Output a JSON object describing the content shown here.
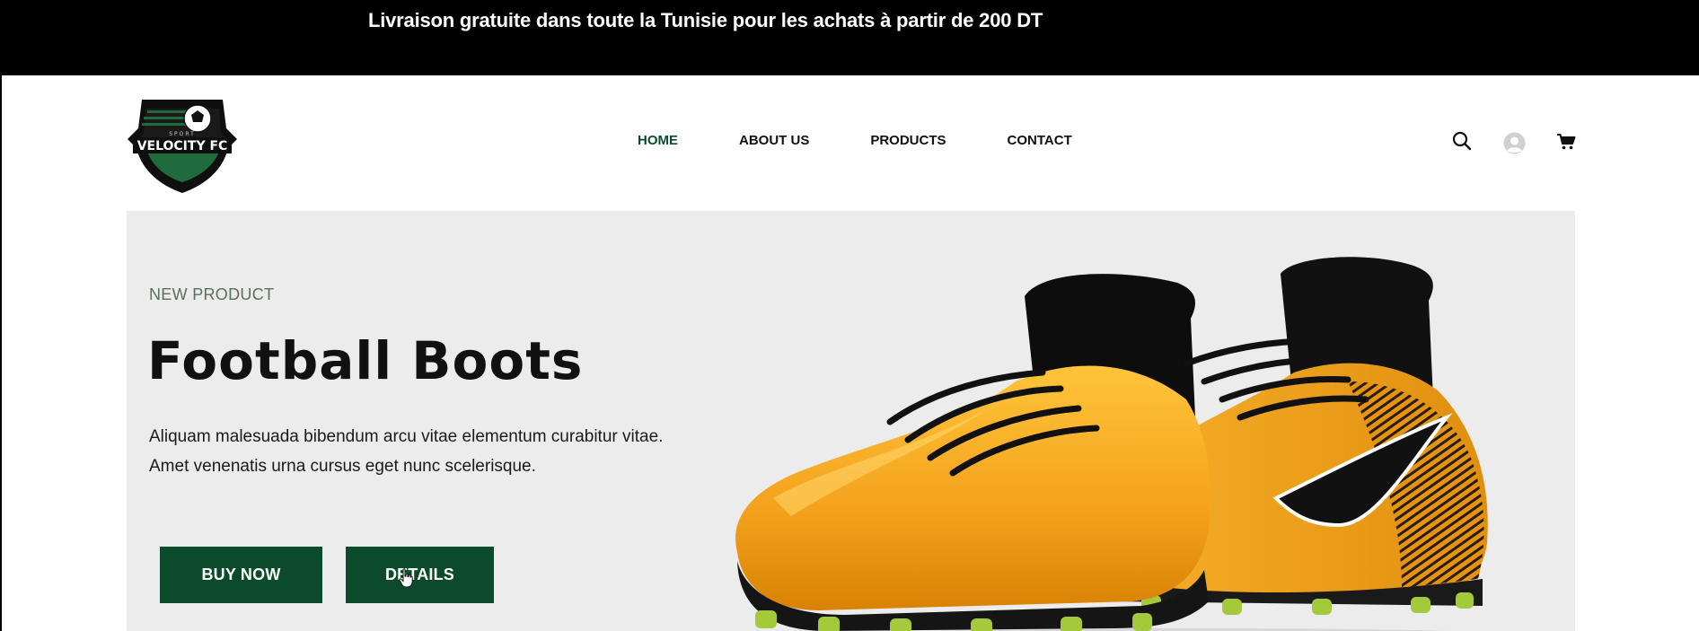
{
  "announcement": {
    "text": "Livraison gratuite dans toute la Tunisie pour les achats à partir de 200 DT"
  },
  "header": {
    "logo_text": "VELOCITY FC",
    "nav": [
      {
        "label": "HOME",
        "active": true
      },
      {
        "label": "ABOUT US",
        "active": false
      },
      {
        "label": "PRODUCTS",
        "active": false
      },
      {
        "label": "CONTACT",
        "active": false
      }
    ],
    "icons": [
      "search-icon",
      "user-icon",
      "cart-icon"
    ]
  },
  "hero": {
    "eyebrow": "NEW PRODUCT",
    "title": "Football Boots",
    "description": [
      "Aliquam malesuada bibendum arcu vitae elementum curabitur vitae.",
      "Amet venenatis urna cursus eget nunc scelerisque."
    ],
    "buttons": {
      "buy_now": "BUY NOW",
      "details": "DETAILS"
    },
    "image": "yellow-football-boots"
  },
  "colors": {
    "brand_green": "#0b4a2b",
    "announcement_bg": "#000000",
    "hero_bg": "#ececec",
    "boot_yellow": "#f5a623"
  }
}
